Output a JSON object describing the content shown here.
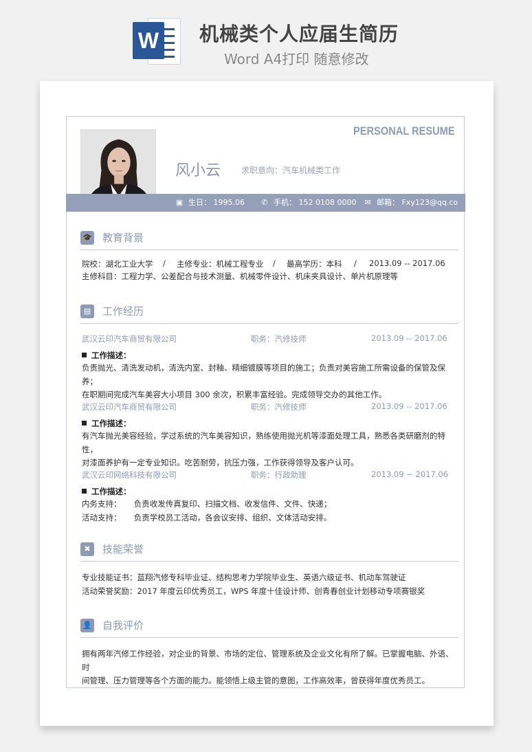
{
  "banner": {
    "title": "机械类个人应届生简历",
    "subtitle": "Word A4打印 随意修改",
    "logo_letter": "W"
  },
  "header": {
    "tag": "PERSONAL RESUME",
    "name": "风小云",
    "intent": "求职意向：汽车机械类工作",
    "birthday": "生日： 1995.06",
    "phone": "手机： 152 0108 0000",
    "email": "邮箱： Fxy123@qq.co"
  },
  "education": {
    "title": "教育背景",
    "school": "院校：湖北工业大学",
    "major": "主修专业：机械工程专业",
    "degree": "最高学历：本科",
    "period": "2013.09 -- 2017.06",
    "sep": "/",
    "courses": "主修科目：工程力学、公差配合与技术测量、机械零件设计、机床夹具设计、单片机原理等"
  },
  "work": {
    "title": "工作经历",
    "desc_label": "工作描述：",
    "jobs": [
      {
        "company": "武汉云印汽车商贸有限公司",
        "role": "职务：汽修技师",
        "period": "2013.09 -- 2017.06",
        "lines": [
          "负责抛光、清洗发动机，清洗内室、封釉、精细镀膜等项目的施工；负责对美容施工所需设备的保管及保养；",
          "在职期间完成汽车美容大小项目 300 余次，积累丰富经验。完成领导交办的其他工作。"
        ]
      },
      {
        "company": "武汉云印汽车商贸有限公司",
        "role": "职务：汽修技师",
        "period": "2013.09 -- 2017.06",
        "lines": [
          "有汽车抛光美容经验，学过系统的汽车美容知识，熟练使用抛光机等漆面处理工具，熟悉各类研磨剂的特性，",
          "对漆面养护有一定专业知识。吃苦耐劳，抗压力强，工作获得领导及客户认可。"
        ]
      },
      {
        "company": "武汉云印网络科技有限公司",
        "role": "职务：行政助理",
        "period": "2013.09 ~ 2017.06",
        "lines": [
          "内务支持：     负责收发传真复印、扫描文档、收发信件、文件、快递；",
          "活动支持：     负责学校员工活动，各会议安排、组织、文体活动安排。"
        ]
      }
    ]
  },
  "skills": {
    "title": "技能荣誉",
    "lines": [
      "专业技能证书：蓝翔汽修专科毕业证、结构思考力学院毕业生、英语六级证书、机动车驾驶证",
      "活动荣誉奖励：2017 年度云印优秀员工，WPS 年度十佳设计师、创青春创业计划移动专项赛银奖"
    ]
  },
  "self": {
    "title": "自我评价",
    "lines": [
      "拥有两年汽修工作经验，对企业的背景、市场的定位、管理系统及企业文化有所了解。已掌握电脑、外语、时",
      "间管理、压力管理等各个方面的能力。能领悟上级主管的意图，工作高效率，曾获得年度优秀员工。"
    ]
  }
}
